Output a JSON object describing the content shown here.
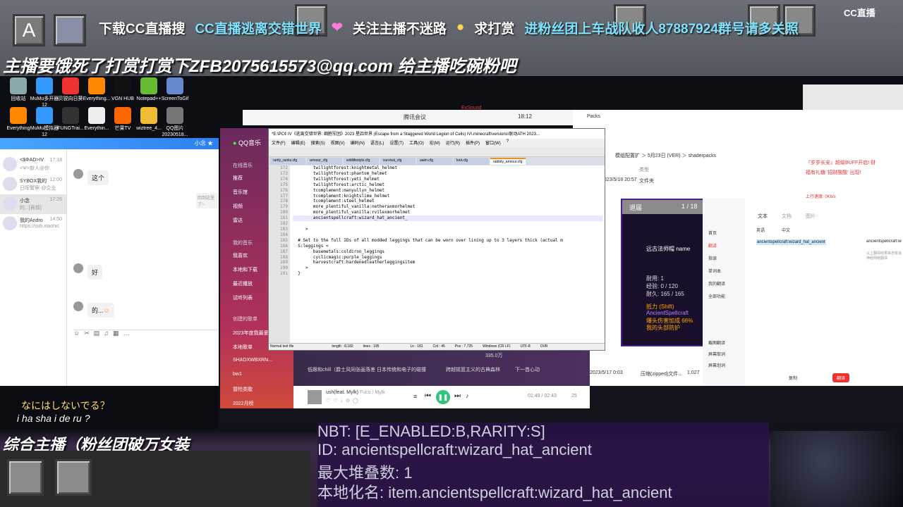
{
  "ticker": {
    "download": "下载CC直播搜",
    "game": "CC直播逃离交错世界",
    "follow": "关注主播不迷路",
    "tip": "求打赏",
    "fans": "进粉丝团上车战队收人87887924群号请多关照"
  },
  "brand": "CC直播",
  "overlay_line": "主播要饿死了打赏打赏下ZFB2075615573@qq.com 给主播吃碗粉吧",
  "desktop_icons": [
    {
      "label": "回收站",
      "color": "#8aa"
    },
    {
      "label": "MuMu多开器12",
      "color": "#39f"
    },
    {
      "label": "贝锐向日葵",
      "color": "#e33"
    },
    {
      "label": "Everything...",
      "color": "#f80"
    },
    {
      "label": "VGN HUB",
      "color": "#111"
    },
    {
      "label": "Notepad++",
      "color": "#6b3"
    },
    {
      "label": "ScreenToGif",
      "color": "#68c"
    },
    {
      "label": "Everything",
      "color": "#f80"
    },
    {
      "label": "MuMu模拟器12",
      "color": "#39f"
    },
    {
      "label": "FUNGTrai...",
      "color": "#333"
    },
    {
      "label": "Everythin...",
      "color": "#eee"
    },
    {
      "label": "芒果TV",
      "color": "#f60"
    },
    {
      "label": "wiztree_4...",
      "color": "#eb3"
    },
    {
      "label": "QQ图片20230518...",
      "color": "#777"
    }
  ],
  "chat": {
    "header": "小念",
    "contacts": [
      {
        "name": "<$ΦAD>IV",
        "time": "17:18",
        "sub": "<Ψ>新人@你"
      },
      {
        "name": "SYBOX我的",
        "time": "12:00",
        "sub": "日晖警察-@企业"
      },
      {
        "name": "小念",
        "time": "17:26",
        "sub": "的...[表情]"
      },
      {
        "name": "我的Andro",
        "time": "14:50",
        "sub": "https://sub.xiaohic"
      }
    ],
    "messages": [
      "这个",
      "好",
      "的..."
    ],
    "forward_hint": "回到这里了~"
  },
  "qqmusic": {
    "title": "QQ音乐",
    "section": "在线音乐",
    "nav": [
      "推荐",
      "音乐馆",
      "视频",
      "雷达"
    ],
    "mine_title": "我的音乐",
    "mine": [
      "我喜欢",
      "本地和下载",
      "最近播放",
      "试听列表"
    ],
    "playlists_title": "创建的歌单",
    "playlists": [
      "2023年度我最爱",
      "本地歌单",
      "SHADXWBXRN...",
      "bw1",
      "冒险类歌",
      "2022月榜"
    ],
    "tiles": [
      "低跟和chill（爵士风同张画落差",
      "日本传统和电子的碰撞",
      "跨越摇篮主义的古典森林",
      "下一首心动"
    ],
    "now_playing": "ush(feat. Mylk)",
    "artist": "Fuco / Mylk",
    "time": "01:49 / 02:43",
    "count": "25",
    "count2": "335.0万"
  },
  "tencent_meet": {
    "title": "腾讯会议",
    "time": "18:12",
    "tab": "ExSound"
  },
  "explorer": {
    "path": "模组配置扩 ＞ 5月23日 (VER) ＞ shaderpacks",
    "tab": "Packs",
    "col_type": "类型",
    "col_file": "文件夹",
    "date": "2023/5/18 20:57",
    "date2": "2023/5/17 0:03",
    "zip": "压缩(zipped)文件...",
    "size": "1,027"
  },
  "notepad": {
    "title": "*E:\\PC¢ IV《逃离交错世界: 细胞军团》2023 星四世界 (Escape from a Staggered World Legion of Cells) IV\\.minecraft\\versions\\联动ATH 2023...",
    "menu": [
      "文件(F)",
      "编辑(E)",
      "搜索(S)",
      "视图(V)",
      "编码(N)",
      "语言(L)",
      "设置(T)",
      "工具(O)",
      "宏(M)",
      "运行(R)",
      "插件(P)",
      "窗口(W)",
      "?"
    ],
    "tabs": [
      "rarity_ranks.cfg",
      "armour_cfg",
      "wildlifestyle.cfg",
      "survival_cfg",
      "aaim.cfg",
      "loot.cfg",
      "rabbity_armour.cfg"
    ],
    "line_numbers": [
      "172",
      "173",
      "174",
      "175",
      "176",
      "177",
      "178",
      "179",
      "180",
      "181",
      "182",
      "183",
      "184",
      "185",
      "186",
      "187",
      "188",
      "189",
      "190",
      "191"
    ],
    "lines": [
      "        twilightforest:knightmetal_helmet",
      "        twilightforest:phantom_helmet",
      "        twilightforest:yeti_helmet",
      "        twilightforest:arctic_helmet",
      "        tcomplement:manyullyn_helmet",
      "        tcomplement:knightslime_helmet",
      "        tcomplement:steel_helmet",
      "        more_plentiful_vanilla:netheraxmorhelmet",
      "        more_plentiful_vanilla:rvilexmorhelmet",
      "        ancientspellcraft:wizard_hat_ancient_",
      "",
      "     >",
      "",
      "  # Set to the full IDs of all modded leggings that can be worn over lining up to 3 layers thick (actual m",
      "  S:leggings <",
      "        basemetals:coldiron_leggings",
      "        cyclicmagic:purple_leggings",
      "        harvestcraft:hardenedleatherleggingsitem",
      "     >",
      "  }"
    ],
    "status": {
      "type": "Normal text file",
      "length": "length : 8,182",
      "lines": "lines : 195",
      "ln": "Ln : 181",
      "col": "Col : 45",
      "pos": "Pos : 7,725",
      "eol": "Windows (CR LF)",
      "enc": "UTF-8",
      "mode": "OVR"
    }
  },
  "mc_tooltip": {
    "button": "退届",
    "page": "1 / 18",
    "name": "远古法师帽 name",
    "lines": [
      "耐用: 1",
      "经验: 0 / 120",
      "耐久: 165 / 165",
      "抵力 (Shift)",
      "AncientSpellcraft",
      "爆头伤害加成 66%",
      "我的头部防护"
    ]
  },
  "translate": {
    "tabs": [
      "文本",
      "文档",
      "图片"
    ],
    "nav": [
      "首页",
      "翻译",
      "指读",
      "单词本",
      "我的翻译",
      "全部功能"
    ],
    "bottom_nav": [
      "截图翻译",
      "屏幕取词",
      "屏幕划词"
    ],
    "lang_from": "英语",
    "lang_to": "中文",
    "input": "ancientspellcraft:wizard_hat_ancient",
    "output": "ancientspellcraft:wizard_hat_ancient",
    "translate_button": "翻译",
    "copy": "复制",
    "note": "以上翻译结果来自有道神经网络翻译"
  },
  "side_chat": {
    "lines": [
      "『岁岁长安』超级BUFF开启! 财",
      "福有礼糖 '招财酸酸' 出现!"
    ],
    "speed": "上行速度: 0Kb/s"
  },
  "karaoke": "なにはしないでる？",
  "romaji": "i ha sha i de ru ?",
  "bottom_title": "综合主播（粉丝团破万女装",
  "bottom_tooltip": {
    "line1": "NBT: [E_ENABLED:B,RARITY:S]",
    "line2": "ID:  ancientspellcraft:wizard_hat_ancient",
    "line3": "最大堆叠数:  1",
    "line4": "本地化名:  item.ancientspellcraft:wizard_hat_ancient"
  },
  "bg_text": "本地化名:"
}
